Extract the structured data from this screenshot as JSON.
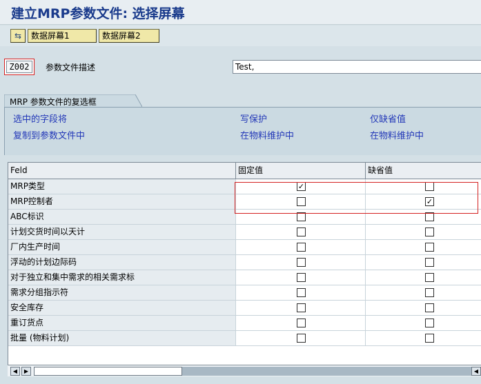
{
  "window": {
    "title": "建立MRP参数文件: 选择屏幕"
  },
  "toolbar": {
    "icon": "switch-screen-icon",
    "button1": "数据屏幕1",
    "button2": "数据屏幕2"
  },
  "profile": {
    "key": "Z002",
    "desc_label": "参数文件描述",
    "desc_value": "Test,"
  },
  "group": {
    "title": "MRP 参数文件的复选框",
    "col1_line1": "选中的字段将",
    "col1_line2": "复制到参数文件中",
    "col2_line1": "写保护",
    "col2_line2": "在物料维护中",
    "col3_line1": "仅缺省值",
    "col3_line2": "在物料维护中"
  },
  "table": {
    "headers": [
      "Feld",
      "固定值",
      "缺省值"
    ],
    "rows": [
      {
        "field": "MRP类型",
        "fixed": true,
        "default": false
      },
      {
        "field": "MRP控制者",
        "fixed": false,
        "default": true
      },
      {
        "field": "ABC标识",
        "fixed": false,
        "default": false
      },
      {
        "field": "计划交货时间以天计",
        "fixed": false,
        "default": false
      },
      {
        "field": "厂内生产时间",
        "fixed": false,
        "default": false
      },
      {
        "field": "浮动的计划边际码",
        "fixed": false,
        "default": false
      },
      {
        "field": "对于独立和集中需求的相关需求标",
        "fixed": false,
        "default": false
      },
      {
        "field": "需求分组指示符",
        "fixed": false,
        "default": false
      },
      {
        "field": "安全库存",
        "fixed": false,
        "default": false
      },
      {
        "field": "重订货点",
        "fixed": false,
        "default": false
      },
      {
        "field": "批量 (物料计划)",
        "fixed": false,
        "default": false
      }
    ]
  },
  "scroll": {
    "left_icon": "scroll-left-icon",
    "right_icon": "scroll-right-icon"
  },
  "colors": {
    "accent": "#d41f1f",
    "link": "#2338b8",
    "title": "#1a3b8c"
  }
}
